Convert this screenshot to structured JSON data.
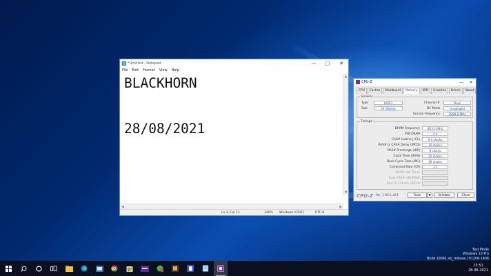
{
  "notepad": {
    "title": "*Untitled - Notepad",
    "menu": [
      "File",
      "Edit",
      "Format",
      "View",
      "Help"
    ],
    "lines": [
      "BLACKHORN",
      "",
      "",
      "28/08/2021"
    ],
    "status": {
      "position": "Ln 3, Col 11",
      "zoom": "340%",
      "line_ending": "Windows (CRLF)",
      "encoding": "UTF-8"
    }
  },
  "cpuz": {
    "title": "CPU-Z",
    "tabs": [
      "CPU",
      "Caches",
      "Mainboard",
      "Memory",
      "SPD",
      "Graphics",
      "Bench",
      "About"
    ],
    "active_tab": "Memory",
    "general": {
      "label": "General",
      "type_label": "Type",
      "type_value": "DDR3",
      "size_label": "Size",
      "size_value": "24 GBytes",
      "channel_label": "Channel #",
      "channel_value": "Dual",
      "dc_label": "DC Mode",
      "dc_value": "Unganged",
      "uncore_label": "Uncore Frequency",
      "uncore_value": "2808.8 MHz"
    },
    "timings": {
      "label": "Timings",
      "rows": [
        {
          "label": "DRAM Frequency",
          "value": "803.5 MHz"
        },
        {
          "label": "FSB:DRAM",
          "value": "1:4"
        },
        {
          "label": "CAS# Latency (CL)",
          "value": "9.0 clocks"
        },
        {
          "label": "RAS# to CAS# Delay (tRCD)",
          "value": "10 clocks"
        },
        {
          "label": "RAS# Precharge (tRP)",
          "value": "9 clocks"
        },
        {
          "label": "Cycle Time (tRAS)",
          "value": "25 clocks"
        },
        {
          "label": "Bank Cycle Time (tRC)",
          "value": "36 clocks"
        },
        {
          "label": "Command Rate (CR)",
          "value": "2T"
        },
        {
          "label": "DRAM Idle Timer",
          "value": ""
        },
        {
          "label": "Total CAS# (tRDRAM)",
          "value": ""
        },
        {
          "label": "Row To Column (tRCD)",
          "value": ""
        }
      ]
    },
    "footer": {
      "logo": "CPU-Z",
      "version": "Ver. 1.96.1.x64",
      "tools_label": "Tools",
      "validate_label": "Validate",
      "close_label": "Close"
    }
  },
  "watermark": {
    "line1": "Test Mode",
    "line2": "Windows 10 Pro",
    "line3": "Build 19041.vb_release.191206-1406"
  },
  "taskbar": {
    "time": "13:51",
    "date": "28-08-2021",
    "icons": [
      "windows-start-icon",
      "search-icon",
      "cortana-icon",
      "task-view-icon",
      "file-explorer-icon",
      "edge-icon",
      "app-icon",
      "chrome-icon",
      "store-icon",
      "app-icon",
      "app-icon",
      "app-icon",
      "app-icon",
      "notepad-icon",
      "cpuz-icon"
    ]
  }
}
